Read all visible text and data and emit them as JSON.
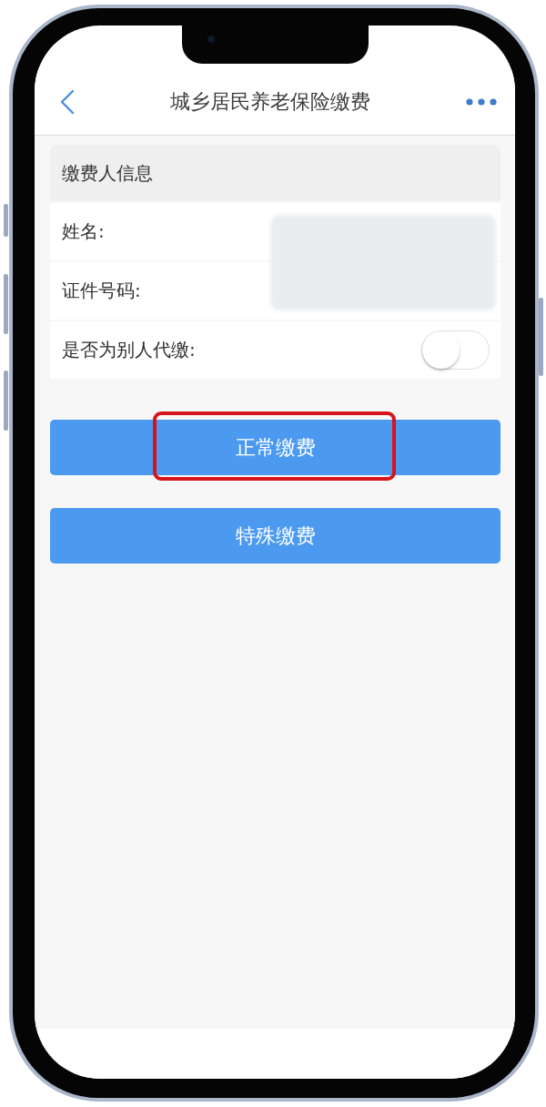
{
  "nav": {
    "title": "城乡居民养老保险缴费"
  },
  "payer_info": {
    "heading": "缴费人信息",
    "redacted": true,
    "rows": [
      {
        "kind": "text",
        "label": "姓名:"
      },
      {
        "kind": "text",
        "label": "证件号码:"
      },
      {
        "kind": "toggle",
        "label": "是否为别人代缴:",
        "on": false
      }
    ]
  },
  "buttons": [
    {
      "label": "正常缴费",
      "highlighted": true
    },
    {
      "label": "特殊缴费",
      "highlighted": false
    }
  ]
}
